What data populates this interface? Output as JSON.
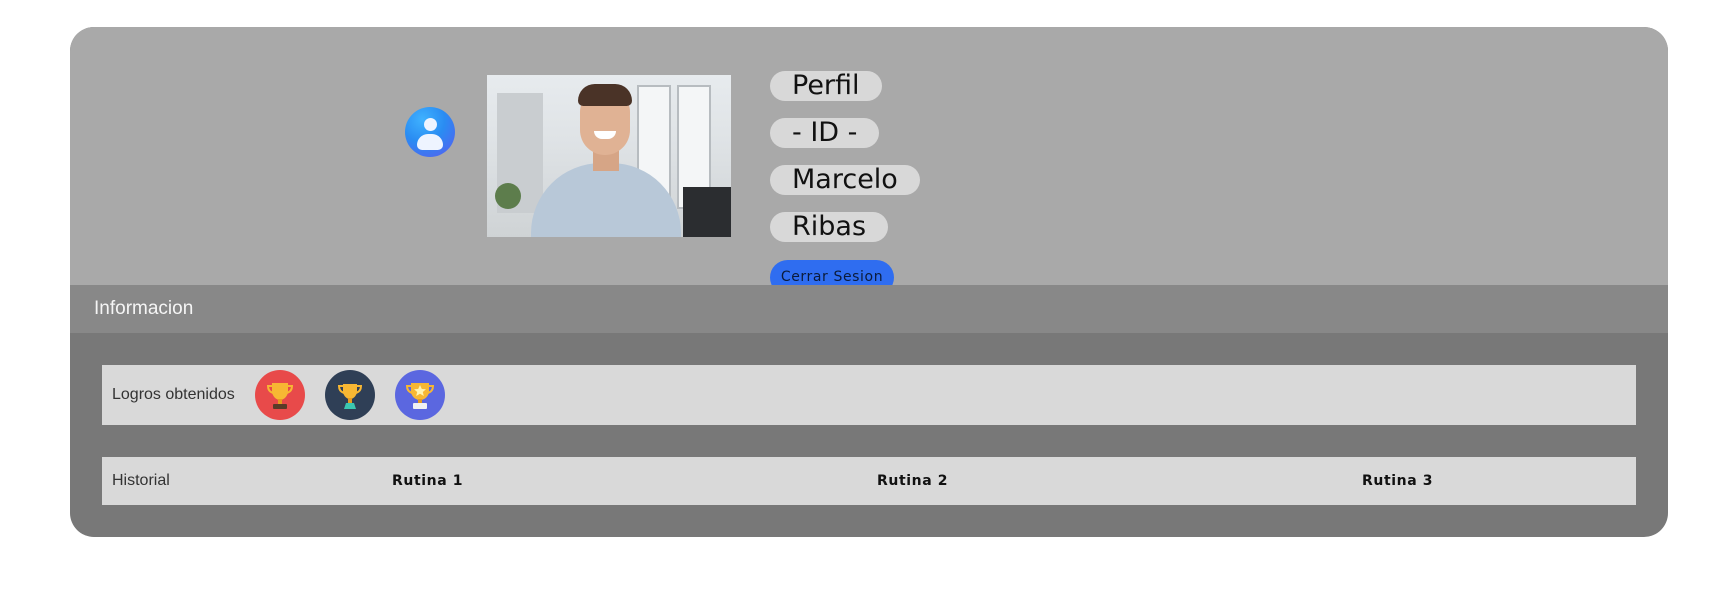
{
  "profile": {
    "title": "Perfil",
    "id_label": "- ID -",
    "first_name": "Marcelo",
    "last_name": "Ribas",
    "logout_label": "Cerrar Sesion",
    "avatar_icon": "user-circle-icon",
    "photo": "profile-photo"
  },
  "info": {
    "title": "Informacion"
  },
  "achievements": {
    "label": "Logros obtenidos",
    "items": [
      {
        "icon": "trophy-icon",
        "color": "#e84a4a"
      },
      {
        "icon": "trophy-icon",
        "color": "#2f3f56"
      },
      {
        "icon": "star-trophy-icon",
        "color": "#5b67e0"
      }
    ]
  },
  "history": {
    "label": "Historial",
    "routines": [
      "Rutina 1",
      "Rutina 2",
      "Rutina 3"
    ]
  },
  "colors": {
    "header_bg": "#a9a9a9",
    "info_bar_bg": "#888888",
    "card_bg": "#787878",
    "row_bg": "#d9d9d9",
    "pill_bg": "#d8d8d8",
    "accent": "#2f6df0"
  }
}
